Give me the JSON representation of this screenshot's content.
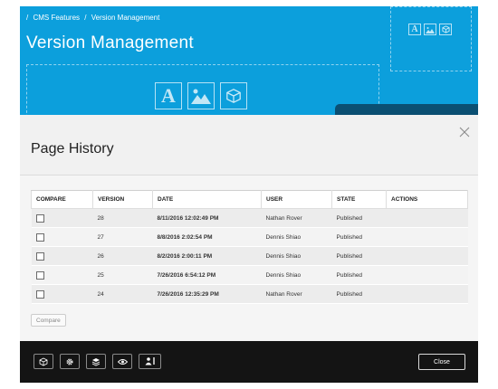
{
  "breadcrumb": [
    "/",
    "CMS Features",
    "/",
    "Version Management"
  ],
  "hero": {
    "title": "Version Management",
    "placeholder_icons": [
      "text-icon",
      "image-icon",
      "box-icon"
    ]
  },
  "modal": {
    "title": "Page History",
    "table": {
      "columns": [
        "COMPARE",
        "VERSION",
        "DATE",
        "USER",
        "STATE",
        "ACTIONS"
      ],
      "rows": [
        {
          "version": "28",
          "date": "8/11/2016 12:02:49 PM",
          "user": "Nathan Rover",
          "state": "Published",
          "actions": ""
        },
        {
          "version": "27",
          "date": "8/8/2016 2:02:54 PM",
          "user": "Dennis Shiao",
          "state": "Published",
          "actions": ""
        },
        {
          "version": "26",
          "date": "8/2/2016 2:00:11 PM",
          "user": "Dennis Shiao",
          "state": "Published",
          "actions": ""
        },
        {
          "version": "25",
          "date": "7/26/2016 6:54:12 PM",
          "user": "Dennis Shiao",
          "state": "Published",
          "actions": ""
        },
        {
          "version": "24",
          "date": "7/26/2016 12:35:29 PM",
          "user": "Nathan Rover",
          "state": "Published",
          "actions": ""
        }
      ]
    },
    "compare_label": "Compare"
  },
  "footer": {
    "tools": [
      "cube-icon",
      "gear-icon",
      "layers-icon",
      "eye-icon",
      "user-icon"
    ],
    "close_label": "Close"
  },
  "colors": {
    "hero_blue": "#0c9fdc",
    "dark_tab": "#0b4f72",
    "footer_bg": "#141414"
  }
}
